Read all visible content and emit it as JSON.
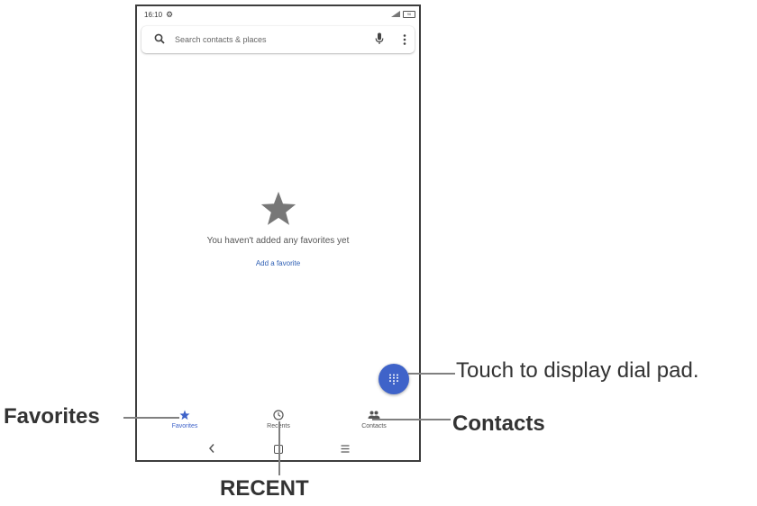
{
  "status_bar": {
    "time": "16:10",
    "battery": "96"
  },
  "search": {
    "placeholder": "Search contacts & places"
  },
  "empty_state": {
    "message": "You haven't added any favorites yet",
    "link": "Add a favorite"
  },
  "bottom_nav": {
    "items": [
      {
        "label": "Favorites",
        "icon": "star-icon",
        "active": true
      },
      {
        "label": "Recents",
        "icon": "clock-icon",
        "active": false
      },
      {
        "label": "Contacts",
        "icon": "people-icon",
        "active": false
      }
    ]
  },
  "annotations": {
    "favorites": "Favorites",
    "recent": "RECENT",
    "contacts": "Contacts",
    "dialpad": "Touch to display dial pad."
  },
  "colors": {
    "accent": "#3f63c9",
    "star_gray": "#777777",
    "link": "#2e5fb4"
  }
}
